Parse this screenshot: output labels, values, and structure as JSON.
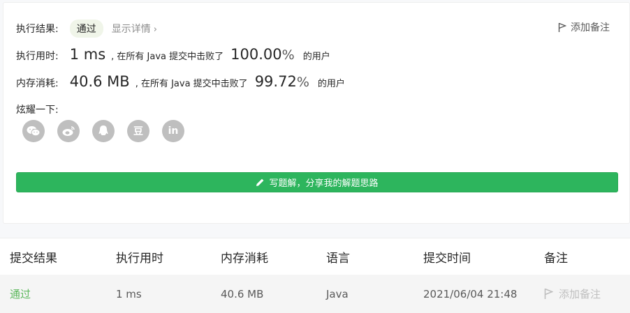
{
  "result": {
    "label": "执行结果:",
    "status": "通过",
    "detail": "显示详情",
    "detail_chevron": "›",
    "add_note": "添加备注"
  },
  "runtime": {
    "label": "执行用时:",
    "value": "1 ms",
    "mid": ", 在所有 Java 提交中击败了",
    "percent": "100.00",
    "percent_sign": "%",
    "tail": "的用户"
  },
  "memory": {
    "label": "内存消耗:",
    "value": "40.6 MB",
    "mid": ", 在所有 Java 提交中击败了",
    "percent": "99.72",
    "percent_sign": "%",
    "tail": "的用户"
  },
  "share": {
    "label": "炫耀一下:",
    "icons": [
      "wechat-icon",
      "weibo-icon",
      "qq-icon",
      "douban-icon",
      "linkedin-icon"
    ],
    "douban_text": "豆",
    "linkedin_text": "in"
  },
  "write_solution": "写题解，分享我的解题思路",
  "table": {
    "headers": [
      "提交结果",
      "执行用时",
      "内存消耗",
      "语言",
      "提交时间",
      "备注"
    ],
    "rows": [
      {
        "result": "通过",
        "time": "1 ms",
        "memory": "40.6 MB",
        "lang": "Java",
        "submitted": "2021/06/04 21:48",
        "note": "添加备注"
      }
    ]
  },
  "colors": {
    "accent_green": "#2db55d",
    "pass_green": "#5cb85c",
    "icon_gray": "#bfbfbf"
  }
}
